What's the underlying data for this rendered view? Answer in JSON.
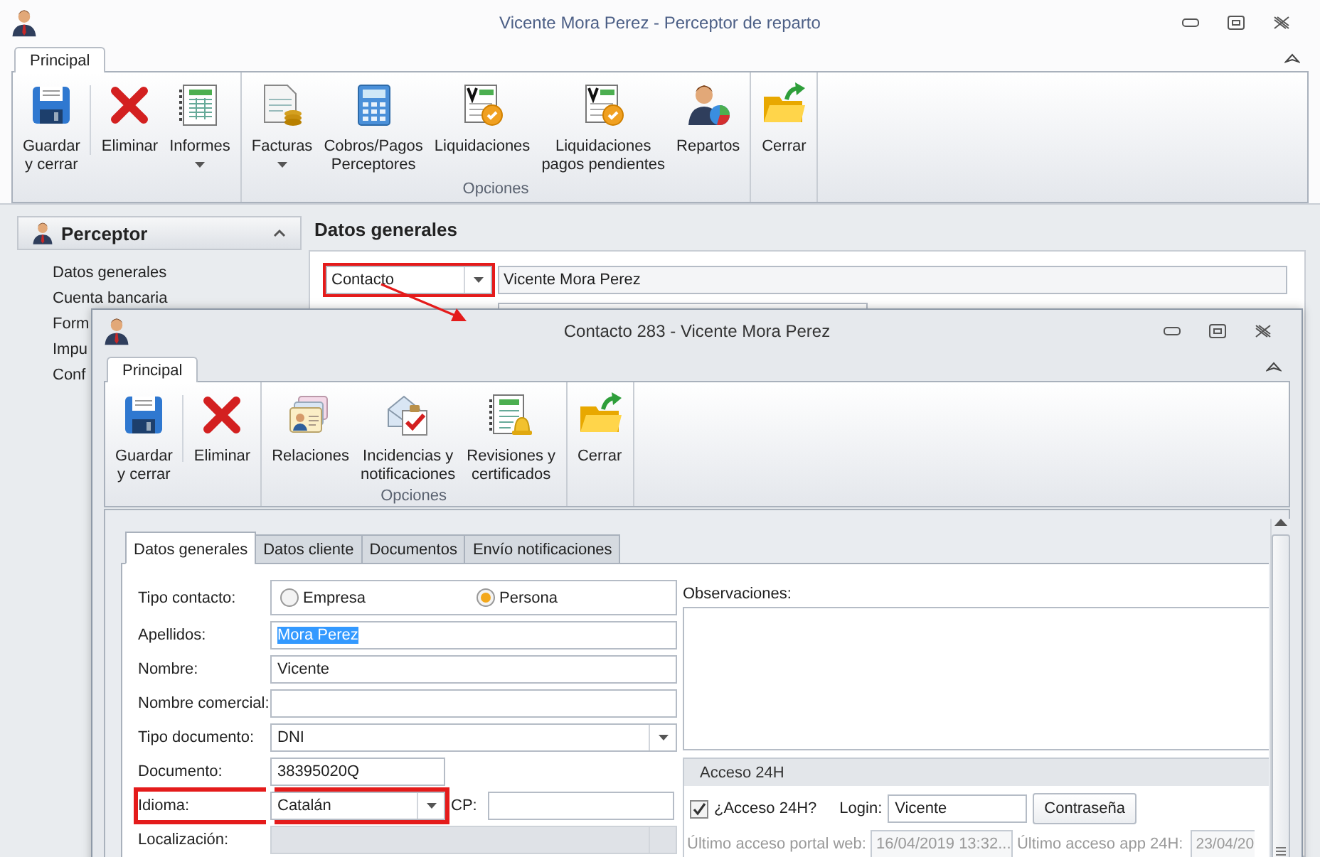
{
  "window": {
    "title": "Vicente Mora Perez - Perceptor de reparto"
  },
  "ribbon": {
    "tabs": [
      {
        "label": "Principal",
        "selected": true
      }
    ],
    "groups": [
      {
        "buttons": [
          {
            "kind": "save",
            "label": "Guardar\ny cerrar",
            "dropdown": false
          },
          {
            "kind": "delete",
            "label": "Eliminar",
            "dropdown": false
          },
          {
            "kind": "report",
            "label": "Informes",
            "dropdown": true
          }
        ]
      },
      {
        "caption": "Opciones",
        "buttons": [
          {
            "kind": "invoice",
            "label": "Facturas",
            "dropdown": true
          },
          {
            "kind": "calculator",
            "label": "Cobros/Pagos\nPerceptores",
            "dropdown": false
          },
          {
            "kind": "settlement",
            "label": "Liquidaciones",
            "dropdown": false
          },
          {
            "kind": "settlement",
            "label": "Liquidaciones\npagos pendientes",
            "dropdown": false
          },
          {
            "kind": "distribution",
            "label": "Repartos",
            "dropdown": false
          }
        ]
      },
      {
        "buttons": [
          {
            "kind": "close",
            "label": "Cerrar",
            "dropdown": false
          }
        ]
      }
    ]
  },
  "sidebar": {
    "title": "Perceptor",
    "expanded": true,
    "items": [
      "Datos generales",
      "Cuenta bancaria",
      "Form",
      "Impu",
      "Conf"
    ]
  },
  "main": {
    "title": "Datos generales",
    "selector": {
      "value": "Contacto",
      "highlighted": true
    },
    "name": "Vicente Mora Perez"
  },
  "dialog": {
    "title": "Contacto 283 - Vicente Mora Perez",
    "ribbon": {
      "tabs": [
        {
          "label": "Principal",
          "selected": true
        }
      ],
      "groups": [
        {
          "buttons": [
            {
              "kind": "save",
              "label": "Guardar\ny cerrar",
              "dropdown": false
            },
            {
              "kind": "delete",
              "label": "Eliminar",
              "dropdown": false
            }
          ]
        },
        {
          "caption": "Opciones",
          "buttons": [
            {
              "kind": "relations",
              "label": "Relaciones",
              "dropdown": false
            },
            {
              "kind": "incidents",
              "label": "Incidencias y\nnotificaciones",
              "dropdown": false
            },
            {
              "kind": "reviews",
              "label": "Revisiones y\ncertificados",
              "dropdown": false
            }
          ]
        },
        {
          "buttons": [
            {
              "kind": "close",
              "label": "Cerrar",
              "dropdown": false
            }
          ]
        }
      ]
    },
    "tabs": [
      {
        "label": "Datos generales",
        "selected": true
      },
      {
        "label": "Datos cliente",
        "selected": false
      },
      {
        "label": "Documentos",
        "selected": false
      },
      {
        "label": "Envío notificaciones",
        "selected": false
      }
    ],
    "form": {
      "rows": [
        {
          "label": "Tipo contacto:",
          "kind": "radio",
          "options": [
            {
              "label": "Empresa",
              "selected": false
            },
            {
              "label": "Persona",
              "selected": true
            }
          ],
          "highlighted": false,
          "disabled": false
        },
        {
          "label": "Apellidos:",
          "kind": "text",
          "value": "Mora Perez",
          "text_selected": true,
          "highlighted": false,
          "disabled": false
        },
        {
          "label": "Nombre:",
          "kind": "text",
          "value": "Vicente",
          "text_selected": false,
          "highlighted": false,
          "disabled": false
        },
        {
          "label": "Nombre comercial:",
          "kind": "text",
          "highlighted": false,
          "disabled": false
        },
        {
          "label": "Tipo documento:",
          "kind": "combo",
          "value": "DNI",
          "highlighted": false,
          "disabled": false
        },
        {
          "label": "Documento:",
          "kind": "code",
          "value": "38395020Q",
          "highlighted": false,
          "disabled": false
        },
        {
          "label": "Idioma:",
          "kind": "combo",
          "value": "Catalán",
          "highlighted": true,
          "disabled": false,
          "extra": {
            "label": "CP:"
          }
        },
        {
          "label": "Localización:",
          "kind": "combo",
          "highlighted": false,
          "disabled": true
        }
      ],
      "notes": {
        "label": "Observaciones:"
      },
      "access": {
        "title": "Acceso 24H",
        "enabled": {
          "label": "¿Acceso 24H?",
          "checked": true
        },
        "login": {
          "label": "Login:",
          "value": "Vicente"
        },
        "password_button": "Contraseña",
        "last_web": {
          "label": "Último acceso portal web:",
          "value": "16/04/2019 13:32..."
        },
        "last_app": {
          "label": "Último acceso app 24H:",
          "value": "23/04/20"
        }
      }
    }
  }
}
